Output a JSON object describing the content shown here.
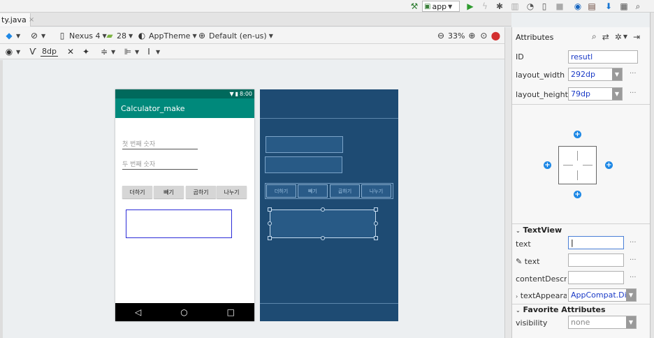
{
  "toolbar_top": {
    "run_config": "app",
    "icons": [
      "hammer-icon",
      "run-icon",
      "apply-changes-icon",
      "debug-icon",
      "profile-icon",
      "attach-icon",
      "stop-icon",
      "avd-icon",
      "sdk-icon",
      "sync-icon",
      "structure-icon",
      "search-icon"
    ]
  },
  "tabs": {
    "active_file": "ty.java",
    "close": "×"
  },
  "design_toolbar": {
    "device": "Nexus 4",
    "api": "28",
    "theme": "AppTheme",
    "locale": "Default (en-us)",
    "zoom": "33%",
    "margin": "8dp"
  },
  "phone": {
    "time": "8:00",
    "app_title": "Calculator_make",
    "first_hint": "첫 번째 숫자",
    "second_hint": "두 번째 숫자",
    "buttons": [
      "더하기",
      "빼기",
      "곱하기",
      "나누기"
    ],
    "nav": [
      "◁",
      "○",
      "□"
    ]
  },
  "blueprint": {
    "buttons": [
      "더하기",
      "빼기",
      "곱하기",
      "나누기"
    ]
  },
  "attributes": {
    "title": "Attributes",
    "id_label": "ID",
    "id_value": "resutl",
    "layout_width_label": "layout_width",
    "layout_width_value": "292dp",
    "layout_height_label": "layout_height",
    "layout_height_value": "79dp",
    "textview_section": "TextView",
    "text_label": "text",
    "text_value": "",
    "tools_text_label": "text",
    "content_desc_label": "contentDescripti",
    "text_appearance_label": "textAppearanc",
    "text_appearance_value": "AppCompat.Displ",
    "favorites_section": "Favorite Attributes",
    "visibility_label": "visibility",
    "visibility_value": "none",
    "more": "···"
  }
}
